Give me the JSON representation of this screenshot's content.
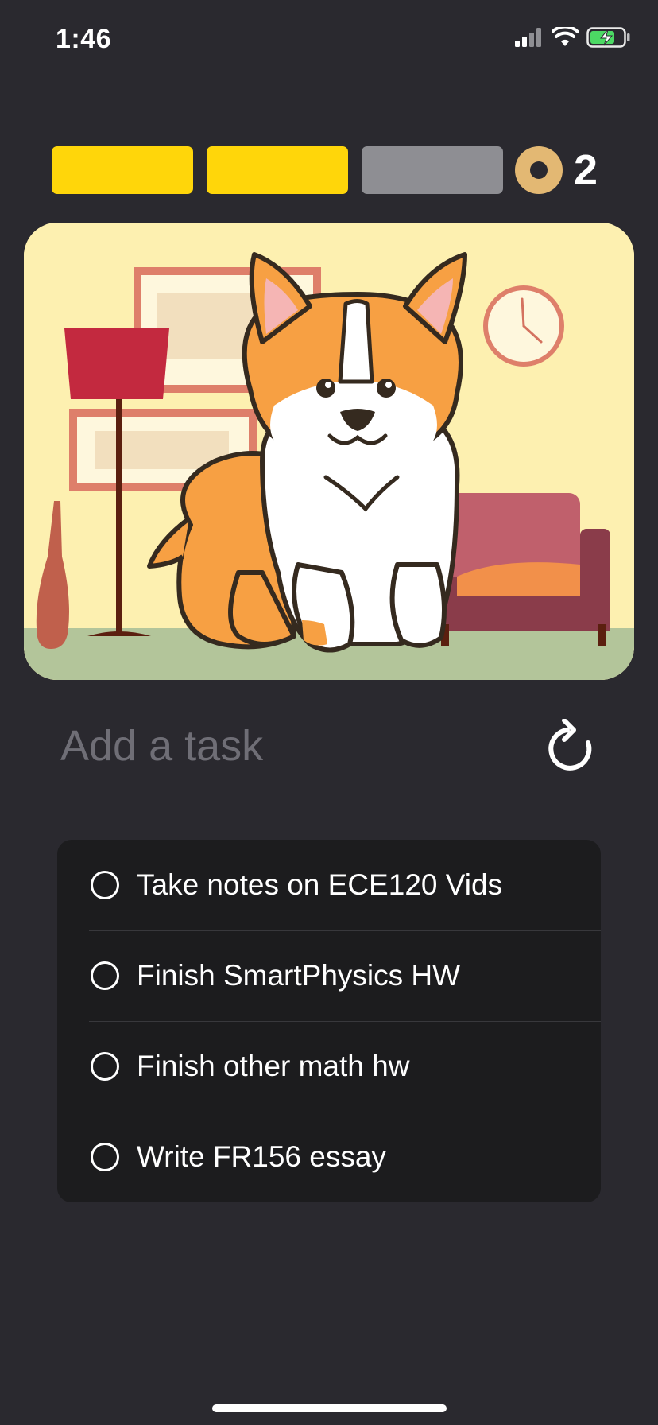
{
  "status_bar": {
    "time": "1:46",
    "icons": [
      "cellular-signal-icon",
      "wifi-icon",
      "battery-charging-icon"
    ]
  },
  "progress": {
    "segments": [
      {
        "state": "filled",
        "color": "#ffd60a"
      },
      {
        "state": "filled",
        "color": "#ffd60a"
      },
      {
        "state": "empty",
        "color": "#8e8e93"
      }
    ],
    "coin_icon": "coin-icon",
    "coin_color": "#e3b873",
    "coin_count": "2"
  },
  "pet": {
    "scene_icon": "corgi-living-room-illustration"
  },
  "add_task": {
    "placeholder": "Add a task",
    "value": "",
    "refresh_icon": "refresh-icon"
  },
  "tasks": [
    {
      "label": "Take notes on ECE120 Vids",
      "done": false
    },
    {
      "label": "Finish SmartPhysics HW",
      "done": false
    },
    {
      "label": "Finish other math hw",
      "done": false
    },
    {
      "label": "Write FR156 essay",
      "done": false
    }
  ],
  "colors": {
    "background": "#2a292f",
    "list_background": "#1c1c1e",
    "accent_yellow": "#ffd60a",
    "placeholder": "#6f6e76"
  }
}
